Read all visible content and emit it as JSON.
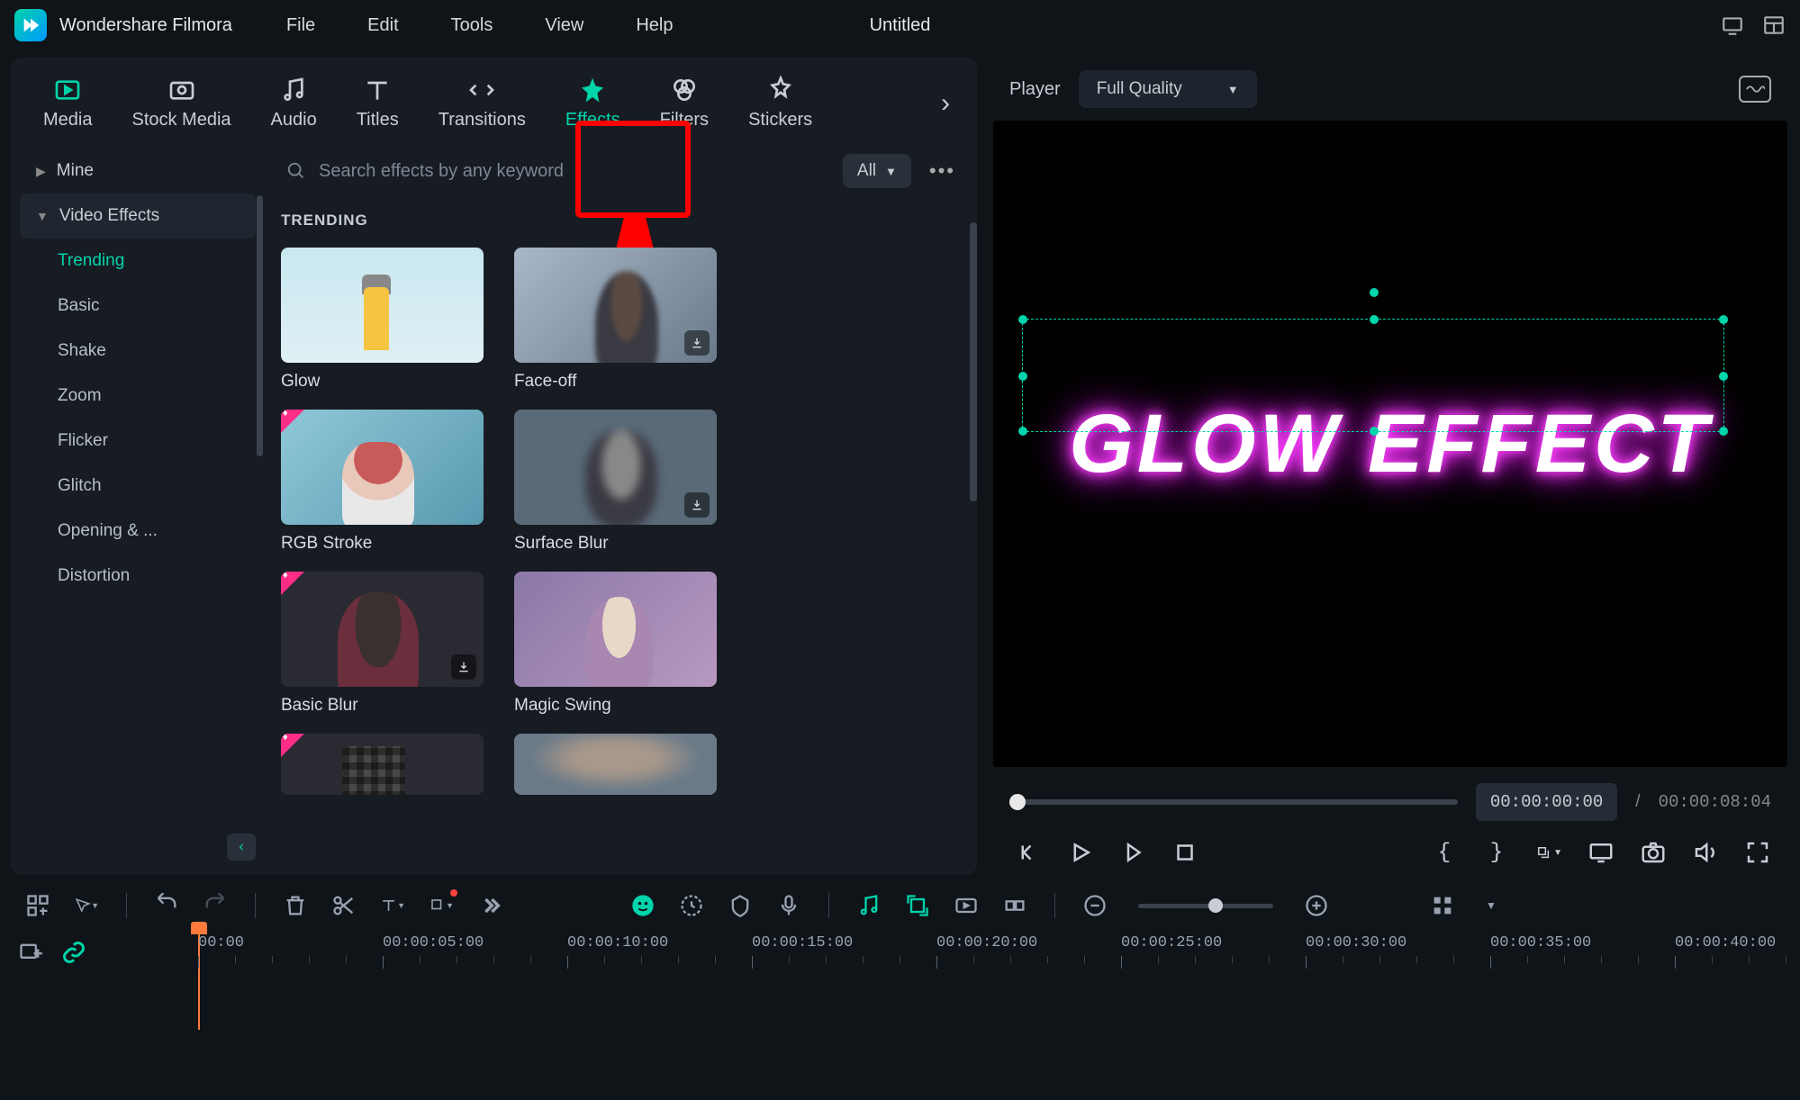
{
  "app": {
    "name": "Wondershare Filmora",
    "title": "Untitled"
  },
  "menu": [
    "File",
    "Edit",
    "Tools",
    "View",
    "Help"
  ],
  "tabs": [
    {
      "id": "media",
      "label": "Media"
    },
    {
      "id": "stock",
      "label": "Stock Media"
    },
    {
      "id": "audio",
      "label": "Audio"
    },
    {
      "id": "titles",
      "label": "Titles"
    },
    {
      "id": "transitions",
      "label": "Transitions"
    },
    {
      "id": "effects",
      "label": "Effects",
      "active": true
    },
    {
      "id": "filters",
      "label": "Filters"
    },
    {
      "id": "stickers",
      "label": "Stickers"
    }
  ],
  "search": {
    "placeholder": "Search effects by any keyword"
  },
  "filter": {
    "label": "All"
  },
  "cats": [
    {
      "label": "Mine",
      "expanded": false
    },
    {
      "label": "Video Effects",
      "expanded": true
    }
  ],
  "subcats": [
    "Trending",
    "Basic",
    "Shake",
    "Zoom",
    "Flicker",
    "Glitch",
    "Opening & ...",
    "Distortion"
  ],
  "section": "TRENDING",
  "cards": [
    {
      "label": "Glow",
      "thumb": "lighthouse",
      "dl": false,
      "badge": false
    },
    {
      "label": "Face-off",
      "thumb": "portrait1",
      "dl": true,
      "badge": false
    },
    {
      "label": "RGB Stroke",
      "thumb": "girlcap",
      "dl": false,
      "badge": true
    },
    {
      "label": "Surface Blur",
      "thumb": "blurface",
      "dl": true,
      "badge": false
    },
    {
      "label": "Basic Blur",
      "thumb": "darkgirl",
      "dl": true,
      "badge": true
    },
    {
      "label": "Magic Swing",
      "thumb": "swing",
      "dl": false,
      "badge": false
    },
    {
      "label": "",
      "thumb": "mosaic",
      "dl": false,
      "badge": true
    },
    {
      "label": "",
      "thumb": "blur2",
      "dl": false,
      "badge": false
    }
  ],
  "player": {
    "label": "Player",
    "quality": "Full Quality",
    "preview_text": "GLOW EFFECT",
    "time_current": "00:00:00:00",
    "time_end": "00:00:08:04"
  },
  "ruler_marks": [
    "00:00",
    "00:00:05:00",
    "00:00:10:00",
    "00:00:15:00",
    "00:00:20:00",
    "00:00:25:00",
    "00:00:30:00",
    "00:00:35:00",
    "00:00:40:00"
  ]
}
